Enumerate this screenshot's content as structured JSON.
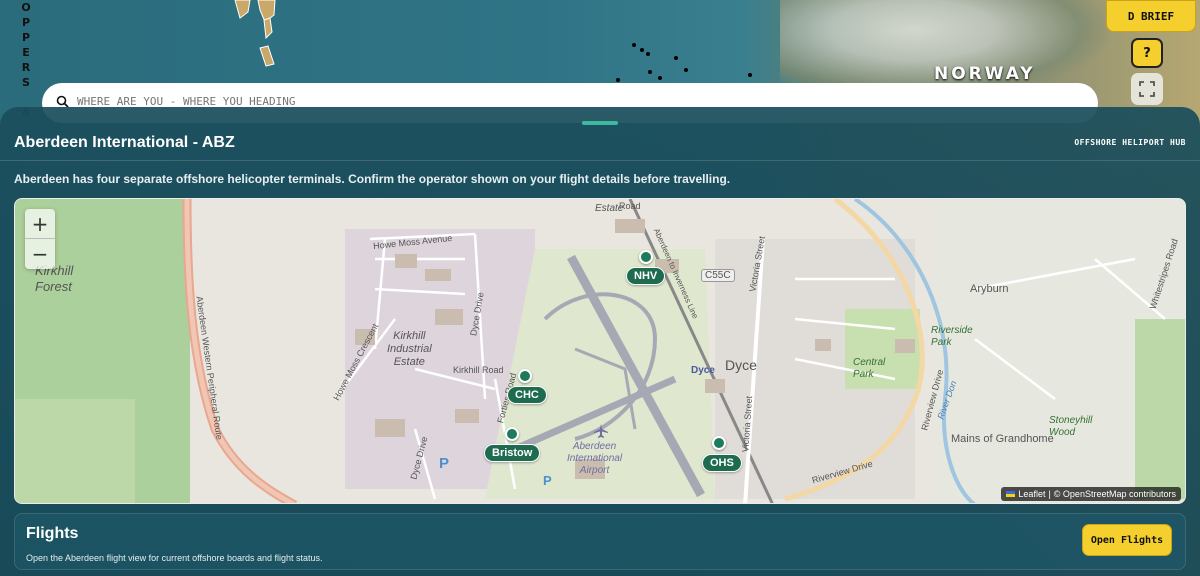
{
  "top_bar": {
    "brief_label": "D BRIEF",
    "help_label": "?",
    "fullscreen_icon": "fullscreen-icon"
  },
  "background_map": {
    "country_label": "NORWAY",
    "vertical_label": "OPPERS A"
  },
  "search": {
    "placeholder": "WHERE ARE YOU - WHERE YOU HEADING",
    "icon": "search-icon"
  },
  "sheet": {
    "title": "Aberdeen International - ABZ",
    "tag": "OFFSHORE HELIPORT HUB",
    "description": "Aberdeen has four separate offshore helicopter terminals. Confirm the operator shown on your flight details before travelling."
  },
  "map": {
    "zoom_in": "+",
    "zoom_out": "−",
    "terminals": [
      {
        "label": "NHV"
      },
      {
        "label": "CHC"
      },
      {
        "label": "Bristow"
      },
      {
        "label": "OHS"
      }
    ],
    "place_labels": {
      "kirkhill_forest": "Kirkhill\nForest",
      "kirkhill_estate": "Kirkhill\nIndustrial\nEstate",
      "aberdeen_airport": "Aberdeen\nInternational\nAirport",
      "dyce": "Dyce",
      "dyce_station": "Dyce",
      "central_park": "Central\nPark",
      "riverside_park": "Riverside\nPark",
      "aryburn": "Aryburn",
      "mains_of_grandhome": "Mains of Grandhome",
      "stoneyhill_wood": "Stoneyhill\nWood",
      "estate": "Estate",
      "c55c": "C55C"
    },
    "road_labels": {
      "howe_moss_avenue": "Howe Moss Avenue",
      "howe_moss_crescent": "Howe Moss Crescent",
      "dyce_drive": "Dyce Drive",
      "dyce_drive_2": "Dyce Drive",
      "kirkhill_road": "Kirkhill Road",
      "forties_road": "Forties Road",
      "victoria_street": "Victoria Street",
      "victoria_street_2": "Victoria Street",
      "riverview_drive": "Riverview Drive",
      "riverview_drive_2": "Riverview Drive",
      "peripheral_route": "Aberdeen Western Peripheral Route",
      "whitestripes_road": "Whitestripes Road",
      "river_don": "River Don",
      "aberdeen_to_inverness": "Aberdeen to Inverness Line",
      "road": "Road"
    },
    "attribution": {
      "leaflet": "Leaflet",
      "separator": "|",
      "osm": "© OpenStreetMap contributors"
    },
    "colors": {
      "marker": "#1d7a5a",
      "pin_label": "#1e6b50",
      "park": "#c8dfb0",
      "forest": "#acd09b"
    }
  },
  "flights": {
    "title": "Flights",
    "description": "Open the Aberdeen flight view for current offshore boards and flight status.",
    "button_label": "Open Flights"
  },
  "colors": {
    "accent_yellow": "#f4cf2d",
    "sheet_bg": "#1b4e5c",
    "handle": "#3fb8a0"
  }
}
